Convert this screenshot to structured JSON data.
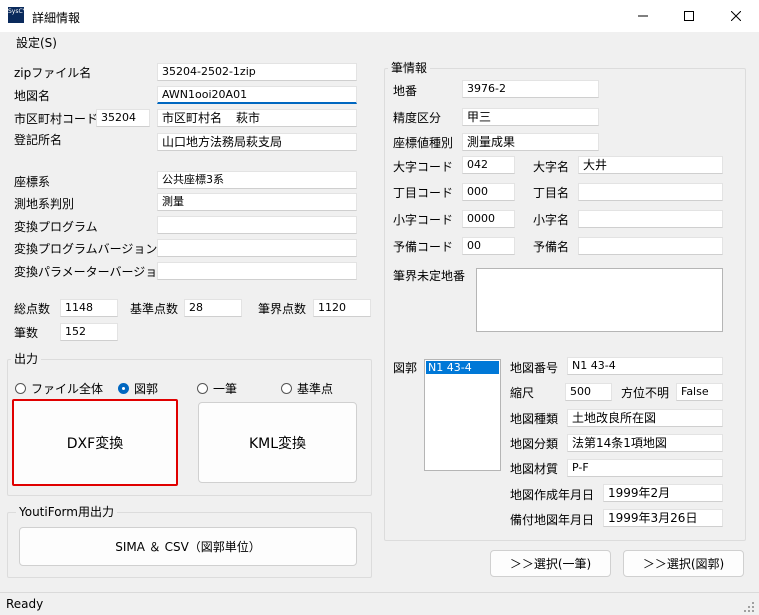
{
  "window": {
    "title": "詳細情報",
    "icon_text": "SysCY"
  },
  "menu": {
    "settings": "設定(S)"
  },
  "left": {
    "zip_label": "zipファイル名",
    "zip_value": "35204-2502-1zip",
    "map_label": "地図名",
    "map_value": "AWN1ooi20A01",
    "city_code_label": "市区町村コード",
    "city_code_value": "35204",
    "city_name_label": "市区町村名",
    "city_name_value": "萩市",
    "registry_label": "登記所名",
    "registry_value": "山口地方法務局萩支局",
    "coord_label": "座標系",
    "coord_value": "公共座標3系",
    "geodetic_label": "測地系判別",
    "geodetic_value": "測量",
    "program_label": "変換プログラム",
    "program_value": "",
    "program_ver_label": "変換プログラムバージョン",
    "program_ver_value": "",
    "param_ver_label": "変換パラメーターバージョン",
    "param_ver_value": "",
    "total_points_label": "総点数",
    "total_points_value": "1148",
    "ref_points_label": "基準点数",
    "ref_points_value": "28",
    "boundary_points_label": "筆界点数",
    "boundary_points_value": "1120",
    "parcel_count_label": "筆数",
    "parcel_count_value": "152"
  },
  "output": {
    "group_title": "出力",
    "radio_file_all": "ファイル全体",
    "radio_zukaku": "図郭",
    "radio_ippitsu": "一筆",
    "radio_kijunten": "基準点",
    "selected": "図郭",
    "dxf_button": "DXF変換",
    "kml_button": "KML変換",
    "highlight_color": "#e00000"
  },
  "youti": {
    "group_title": "YoutiForm用出力",
    "sima_button": "SIMA ＆ CSV（図郭単位）"
  },
  "parcel": {
    "group_title": "筆情報",
    "chiban_label": "地番",
    "chiban_value": "3976-2",
    "precision_label": "精度区分",
    "precision_value": "甲三",
    "coord_type_label": "座標値種別",
    "coord_type_value": "測量成果",
    "oaza_code_label": "大字コード",
    "oaza_code_value": "042",
    "oaza_name_label": "大字名",
    "oaza_name_value": "大井",
    "chome_code_label": "丁目コード",
    "chome_code_value": "000",
    "chome_name_label": "丁目名",
    "chome_name_value": "",
    "koaza_code_label": "小字コード",
    "koaza_code_value": "0000",
    "koaza_name_label": "小字名",
    "koaza_name_value": "",
    "yobi_code_label": "予備コード",
    "yobi_code_value": "00",
    "yobi_name_label": "予備名",
    "yobi_name_value": "",
    "undetermined_label": "筆界未定地番",
    "undetermined_value": ""
  },
  "zukaku": {
    "label": "図郭",
    "list_items": [
      "N1 43-4"
    ],
    "map_no_label": "地図番号",
    "map_no_value": "N1 43-4",
    "scale_label": "縮尺",
    "scale_value": "500",
    "direction_label": "方位不明",
    "direction_value": "False",
    "map_type_label": "地図種類",
    "map_type_value": "土地改良所在図",
    "map_class_label": "地図分類",
    "map_class_value": "法第14条1項地図",
    "material_label": "地図材質",
    "material_value": "P-F",
    "created_label": "地図作成年月日",
    "created_value": "1999年2月",
    "registry_date_label": "備付地図年月日",
    "registry_date_value": "1999年3月26日"
  },
  "buttons": {
    "select_ippitsu": "＞＞選択(一筆)",
    "select_zukaku": "＞＞選択(図郭)"
  },
  "status": {
    "text": "Ready"
  }
}
